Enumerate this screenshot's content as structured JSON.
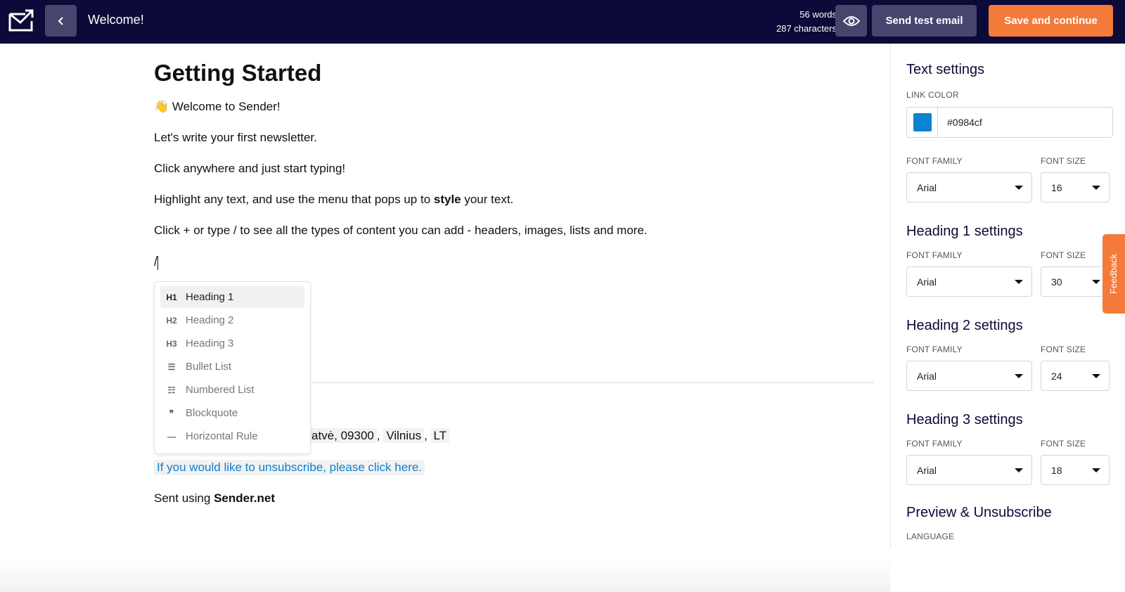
{
  "header": {
    "title": "Welcome!",
    "word_count": "56 words",
    "char_count": "287 characters",
    "send_test_label": "Send test email",
    "save_label": "Save and continue"
  },
  "document": {
    "heading": "Getting Started",
    "welcome_emoji": "👋",
    "welcome_text": "Welcome to Sender!",
    "p1": "Let's write your first newsletter.",
    "p2": "Click anywhere and just start typing!",
    "p3_before": "Highlight any text, and use the menu that pops up to ",
    "p3_bold": "style",
    "p3_after": " your text.",
    "p4": "Click + or type / to see all the types of content you can add - headers, images, lists and more.",
    "slash": "/",
    "address_part": "atvė, 09300",
    "city": "Vilnius",
    "country": "LT",
    "unsubscribe": "If you would like to unsubscribe, please click here.",
    "sent_prefix": "Sent using ",
    "sent_brand": "Sender.net"
  },
  "slash_menu": {
    "items": [
      {
        "icon": "H1",
        "label": "Heading 1"
      },
      {
        "icon": "H2",
        "label": "Heading 2"
      },
      {
        "icon": "H3",
        "label": "Heading 3"
      },
      {
        "icon": "☰",
        "label": "Bullet List"
      },
      {
        "icon": "☷",
        "label": "Numbered List"
      },
      {
        "icon": "❞",
        "label": "Blockquote"
      },
      {
        "icon": "—",
        "label": "Horizontal Rule"
      }
    ]
  },
  "panel": {
    "text_settings": {
      "title": "Text settings",
      "link_color_label": "LINK COLOR",
      "link_color": "#0984cf",
      "font_family_label": "FONT FAMILY",
      "font_size_label": "FONT SIZE",
      "font_family": "Arial",
      "font_size": "16"
    },
    "h1": {
      "title": "Heading 1 settings",
      "font_family_label": "FONT FAMILY",
      "font_size_label": "FONT SIZE",
      "font_family": "Arial",
      "font_size": "30"
    },
    "h2": {
      "title": "Heading 2 settings",
      "font_family_label": "FONT FAMILY",
      "font_size_label": "FONT SIZE",
      "font_family": "Arial",
      "font_size": "24"
    },
    "h3": {
      "title": "Heading 3 settings",
      "font_family_label": "FONT FAMILY",
      "font_size_label": "FONT SIZE",
      "font_family": "Arial",
      "font_size": "18"
    },
    "preview": {
      "title": "Preview & Unsubscribe",
      "language_label": "LANGUAGE"
    }
  },
  "feedback_label": "Feedback",
  "colors": {
    "topbar": "#0b0a38",
    "accent": "#f47a3a",
    "link": "#0984cf"
  }
}
